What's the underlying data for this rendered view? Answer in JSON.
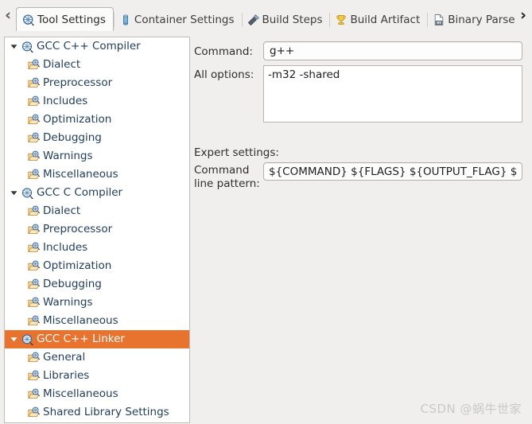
{
  "tabbar": {
    "scroll_left_label": "‹",
    "scroll_right_label": "›",
    "tabs": [
      {
        "label": "Tool Settings",
        "icon": "tool-settings-icon",
        "active": true
      },
      {
        "label": "Container Settings",
        "icon": "container-settings-icon",
        "active": false
      },
      {
        "label": "Build Steps",
        "icon": "build-steps-icon",
        "active": false
      },
      {
        "label": "Build Artifact",
        "icon": "build-artifact-icon",
        "active": false
      },
      {
        "label": "Binary Parsers",
        "icon": "binary-parsers-icon",
        "active": false
      }
    ]
  },
  "tree": {
    "nodes": [
      {
        "label": "GCC C++ Compiler",
        "level": 0,
        "expanded": true,
        "selected": false,
        "icon": "compiler-globe-icon"
      },
      {
        "label": "Dialect",
        "level": 1,
        "expanded": null,
        "selected": false,
        "icon": "settings-folder-icon"
      },
      {
        "label": "Preprocessor",
        "level": 1,
        "expanded": null,
        "selected": false,
        "icon": "settings-folder-icon"
      },
      {
        "label": "Includes",
        "level": 1,
        "expanded": null,
        "selected": false,
        "icon": "settings-folder-icon"
      },
      {
        "label": "Optimization",
        "level": 1,
        "expanded": null,
        "selected": false,
        "icon": "settings-folder-icon"
      },
      {
        "label": "Debugging",
        "level": 1,
        "expanded": null,
        "selected": false,
        "icon": "settings-folder-icon"
      },
      {
        "label": "Warnings",
        "level": 1,
        "expanded": null,
        "selected": false,
        "icon": "settings-folder-icon"
      },
      {
        "label": "Miscellaneous",
        "level": 1,
        "expanded": null,
        "selected": false,
        "icon": "settings-folder-icon"
      },
      {
        "label": "GCC C Compiler",
        "level": 0,
        "expanded": true,
        "selected": false,
        "icon": "compiler-globe-icon"
      },
      {
        "label": "Dialect",
        "level": 1,
        "expanded": null,
        "selected": false,
        "icon": "settings-folder-icon"
      },
      {
        "label": "Preprocessor",
        "level": 1,
        "expanded": null,
        "selected": false,
        "icon": "settings-folder-icon"
      },
      {
        "label": "Includes",
        "level": 1,
        "expanded": null,
        "selected": false,
        "icon": "settings-folder-icon"
      },
      {
        "label": "Optimization",
        "level": 1,
        "expanded": null,
        "selected": false,
        "icon": "settings-folder-icon"
      },
      {
        "label": "Debugging",
        "level": 1,
        "expanded": null,
        "selected": false,
        "icon": "settings-folder-icon"
      },
      {
        "label": "Warnings",
        "level": 1,
        "expanded": null,
        "selected": false,
        "icon": "settings-folder-icon"
      },
      {
        "label": "Miscellaneous",
        "level": 1,
        "expanded": null,
        "selected": false,
        "icon": "settings-folder-icon"
      },
      {
        "label": "GCC C++ Linker",
        "level": 0,
        "expanded": true,
        "selected": true,
        "icon": "compiler-globe-icon"
      },
      {
        "label": "General",
        "level": 1,
        "expanded": null,
        "selected": false,
        "icon": "settings-folder-icon"
      },
      {
        "label": "Libraries",
        "level": 1,
        "expanded": null,
        "selected": false,
        "icon": "settings-folder-icon"
      },
      {
        "label": "Miscellaneous",
        "level": 1,
        "expanded": null,
        "selected": false,
        "icon": "settings-folder-icon"
      },
      {
        "label": "Shared Library Settings",
        "level": 1,
        "expanded": null,
        "selected": false,
        "icon": "settings-folder-icon"
      }
    ]
  },
  "form": {
    "command_label": "Command:",
    "command_value": "g++",
    "options_label": "All options:",
    "options_value": "-m32 -shared",
    "expert_label": "Expert settings:",
    "pattern_label_line1": "Command",
    "pattern_label_line2": "line pattern:",
    "pattern_value": "${COMMAND} ${FLAGS} ${OUTPUT_FLAG} ${OUTPUT} ${INPUTS}"
  },
  "watermark": {
    "text": "CSDN @蜗牛世家"
  },
  "colors": {
    "selection": "#e8732e",
    "window_bg": "#f0efee",
    "tree_bg": "#ffffff",
    "tree_text": "#1f3c5f"
  }
}
